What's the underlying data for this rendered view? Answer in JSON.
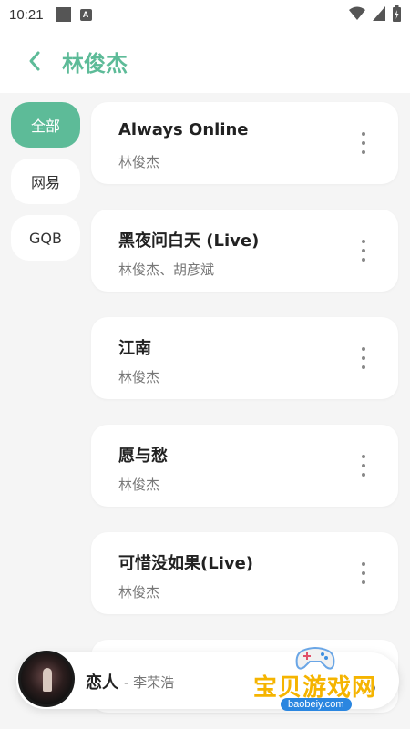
{
  "status_bar": {
    "time": "10:21",
    "notification_icon": "A"
  },
  "header": {
    "back_icon": "chevron-left-icon",
    "title": "林俊杰"
  },
  "sidebar": {
    "tabs": [
      {
        "label": "全部",
        "active": true
      },
      {
        "label": "网易",
        "active": false
      },
      {
        "label": "GQB",
        "active": false
      }
    ]
  },
  "songs": [
    {
      "title": "Always Online",
      "artist": "林俊杰"
    },
    {
      "title": "黑夜问白天 (Live)",
      "artist": "林俊杰、胡彦斌"
    },
    {
      "title": "江南",
      "artist": "林俊杰"
    },
    {
      "title": "愿与愁",
      "artist": "林俊杰"
    },
    {
      "title": "可惜没如果(Live)",
      "artist": "林俊杰"
    }
  ],
  "player": {
    "title": "恋人",
    "artist": "- 李荣浩"
  },
  "watermark": {
    "text": "宝贝游戏网",
    "url": "baobeiy.com"
  },
  "colors": {
    "accent": "#5dbb98",
    "background": "#f5f5f5",
    "card": "#ffffff"
  }
}
